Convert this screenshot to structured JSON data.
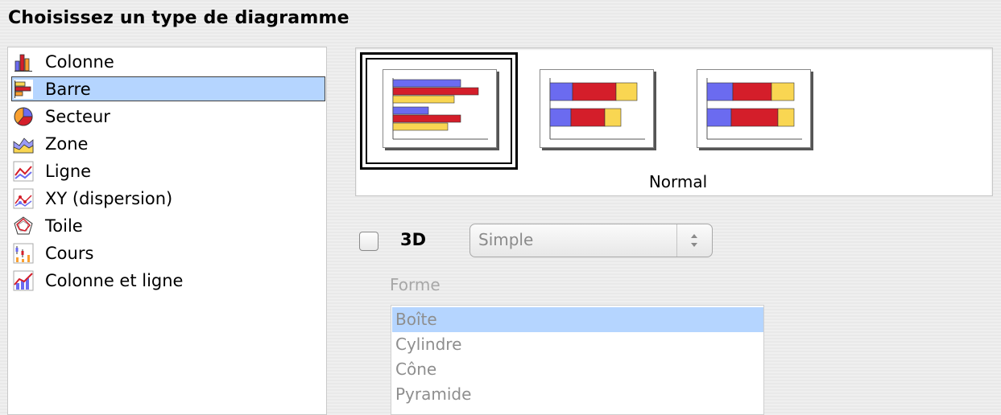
{
  "dialog": {
    "title": "Choisissez un type de diagramme"
  },
  "chart_types": [
    {
      "label": "Colonne",
      "icon": "column-chart-icon",
      "selected": false
    },
    {
      "label": "Barre",
      "icon": "bar-chart-icon",
      "selected": true
    },
    {
      "label": "Secteur",
      "icon": "pie-chart-icon",
      "selected": false
    },
    {
      "label": "Zone",
      "icon": "area-chart-icon",
      "selected": false
    },
    {
      "label": "Ligne",
      "icon": "line-chart-icon",
      "selected": false
    },
    {
      "label": "XY (dispersion)",
      "icon": "scatter-chart-icon",
      "selected": false
    },
    {
      "label": "Toile",
      "icon": "radar-chart-icon",
      "selected": false
    },
    {
      "label": "Cours",
      "icon": "stock-chart-icon",
      "selected": false
    },
    {
      "label": "Colonne et ligne",
      "icon": "column-line-chart-icon",
      "selected": false
    }
  ],
  "variants": {
    "selected_label": "Normal",
    "items": [
      {
        "icon": "bar-normal-variant-icon",
        "selected": true
      },
      {
        "icon": "bar-stacked-variant-icon",
        "selected": false
      },
      {
        "icon": "bar-percent-stacked-variant-icon",
        "selected": false
      }
    ]
  },
  "options": {
    "three_d_label": "3D",
    "three_d_checked": false,
    "style_select_value": "Simple",
    "shape_label": "Forme",
    "shapes": [
      {
        "label": "Boîte",
        "selected": true
      },
      {
        "label": "Cylindre",
        "selected": false
      },
      {
        "label": "Cône",
        "selected": false
      },
      {
        "label": "Pyramide",
        "selected": false
      }
    ]
  },
  "colors": {
    "selection": "#b5d5ff",
    "series_blue": "#6b6bf0",
    "series_red": "#d41e2a",
    "series_yellow": "#f9d652"
  }
}
